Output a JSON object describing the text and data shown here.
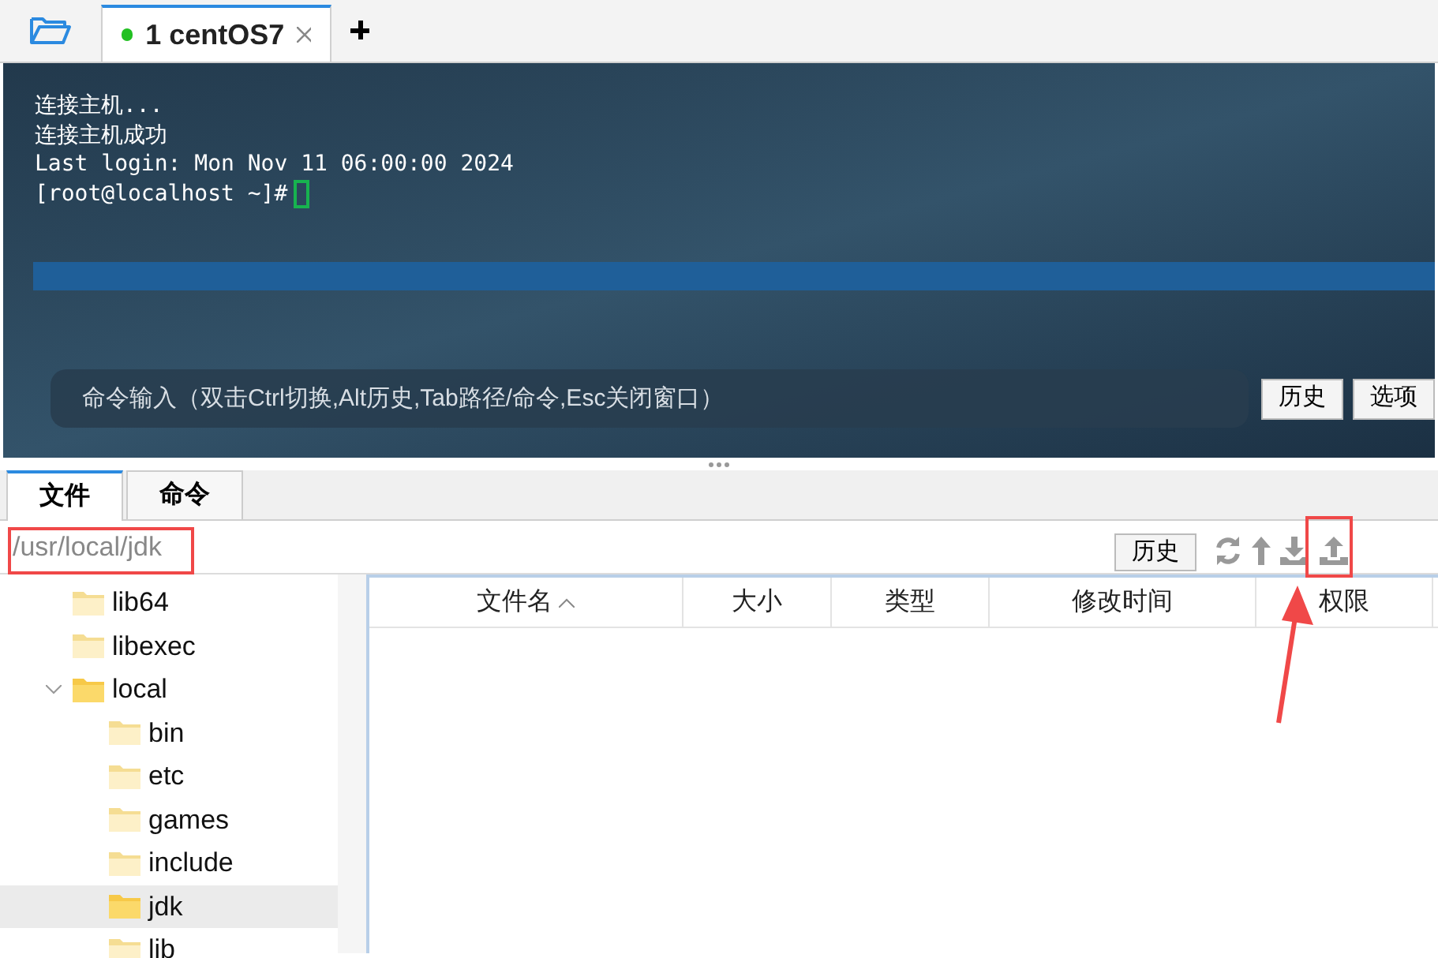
{
  "session_tabs": [
    {
      "label": "1 centOS7",
      "selected": true,
      "connected": true
    }
  ],
  "terminal": {
    "lines": [
      "连接主机...",
      "连接主机成功",
      "Last login: Mon Nov 11 06:00:00 2024"
    ],
    "prompt": "[root@localhost ~]#",
    "command_bar": {
      "placeholder": "命令输入（双击Ctrl切换,Alt历史,Tab路径/命令,Esc关闭窗口）",
      "buttons": [
        "历史",
        "选项"
      ]
    }
  },
  "panel_tabs": [
    {
      "label": "文件",
      "selected": true
    },
    {
      "label": "命令",
      "selected": false
    }
  ],
  "path_field": {
    "value": "/usr/local/jdk"
  },
  "history_button": "历史",
  "toolbar": [
    {
      "kind": "refresh"
    },
    {
      "kind": "up"
    },
    {
      "kind": "download"
    },
    {
      "kind": "upload"
    }
  ],
  "tree": [
    {
      "name": "lib64",
      "selected": false
    },
    {
      "name": "libexec",
      "selected": false
    },
    {
      "name": "local",
      "selected": false,
      "expanded": true,
      "children": [
        {
          "name": "bin",
          "selected": false
        },
        {
          "name": "etc",
          "selected": false
        },
        {
          "name": "games",
          "selected": false
        },
        {
          "name": "include",
          "selected": false
        },
        {
          "name": "jdk",
          "selected": true
        },
        {
          "name": "lib",
          "selected": false
        }
      ]
    }
  ],
  "table": {
    "columns": [
      {
        "label": "文件名",
        "sorted": true
      },
      {
        "label": "大小",
        "sorted": false
      },
      {
        "label": "类型",
        "sorted": false
      },
      {
        "label": "修改时间",
        "sorted": false
      },
      {
        "label": "权限",
        "sorted": false
      }
    ]
  }
}
